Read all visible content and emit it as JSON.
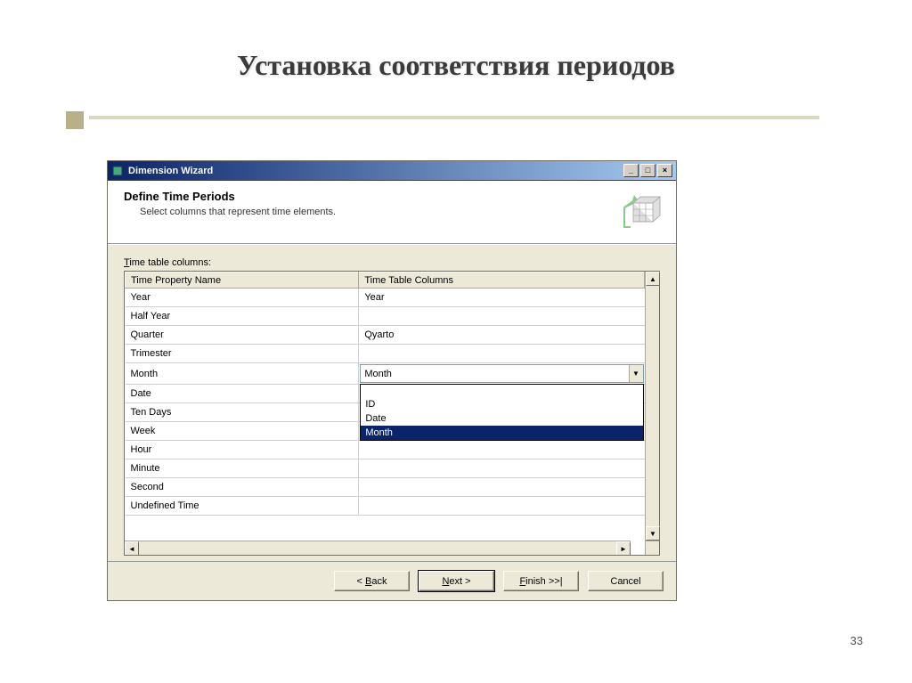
{
  "slide": {
    "title": "Установка соответствия периодов",
    "page_number": "33"
  },
  "dialog": {
    "title": "Dimension Wizard",
    "header": {
      "title": "Define Time Periods",
      "subtitle": "Select columns that represent time elements."
    },
    "field_label_prefix": "T",
    "field_label_rest": "ime table columns:",
    "columns": {
      "name": "Time Property Name",
      "value": "Time Table Columns"
    },
    "rows": [
      {
        "name": "Year",
        "value": "Year"
      },
      {
        "name": "Half Year",
        "value": ""
      },
      {
        "name": "Quarter",
        "value": "Qyarto"
      },
      {
        "name": "Trimester",
        "value": ""
      },
      {
        "name": "Month",
        "value": "Month"
      },
      {
        "name": "Date",
        "value": ""
      },
      {
        "name": "Ten Days",
        "value": ""
      },
      {
        "name": "Week",
        "value": ""
      },
      {
        "name": "Hour",
        "value": ""
      },
      {
        "name": "Minute",
        "value": ""
      },
      {
        "name": "Second",
        "value": ""
      },
      {
        "name": "Undefined Time",
        "value": ""
      }
    ],
    "dropdown": {
      "blank": "",
      "option1": "ID",
      "option2": "Date",
      "option3": "Month"
    },
    "buttons": {
      "back": "< Back",
      "next": "Next >",
      "finish": "Finish >>|",
      "cancel": "Cancel"
    }
  }
}
